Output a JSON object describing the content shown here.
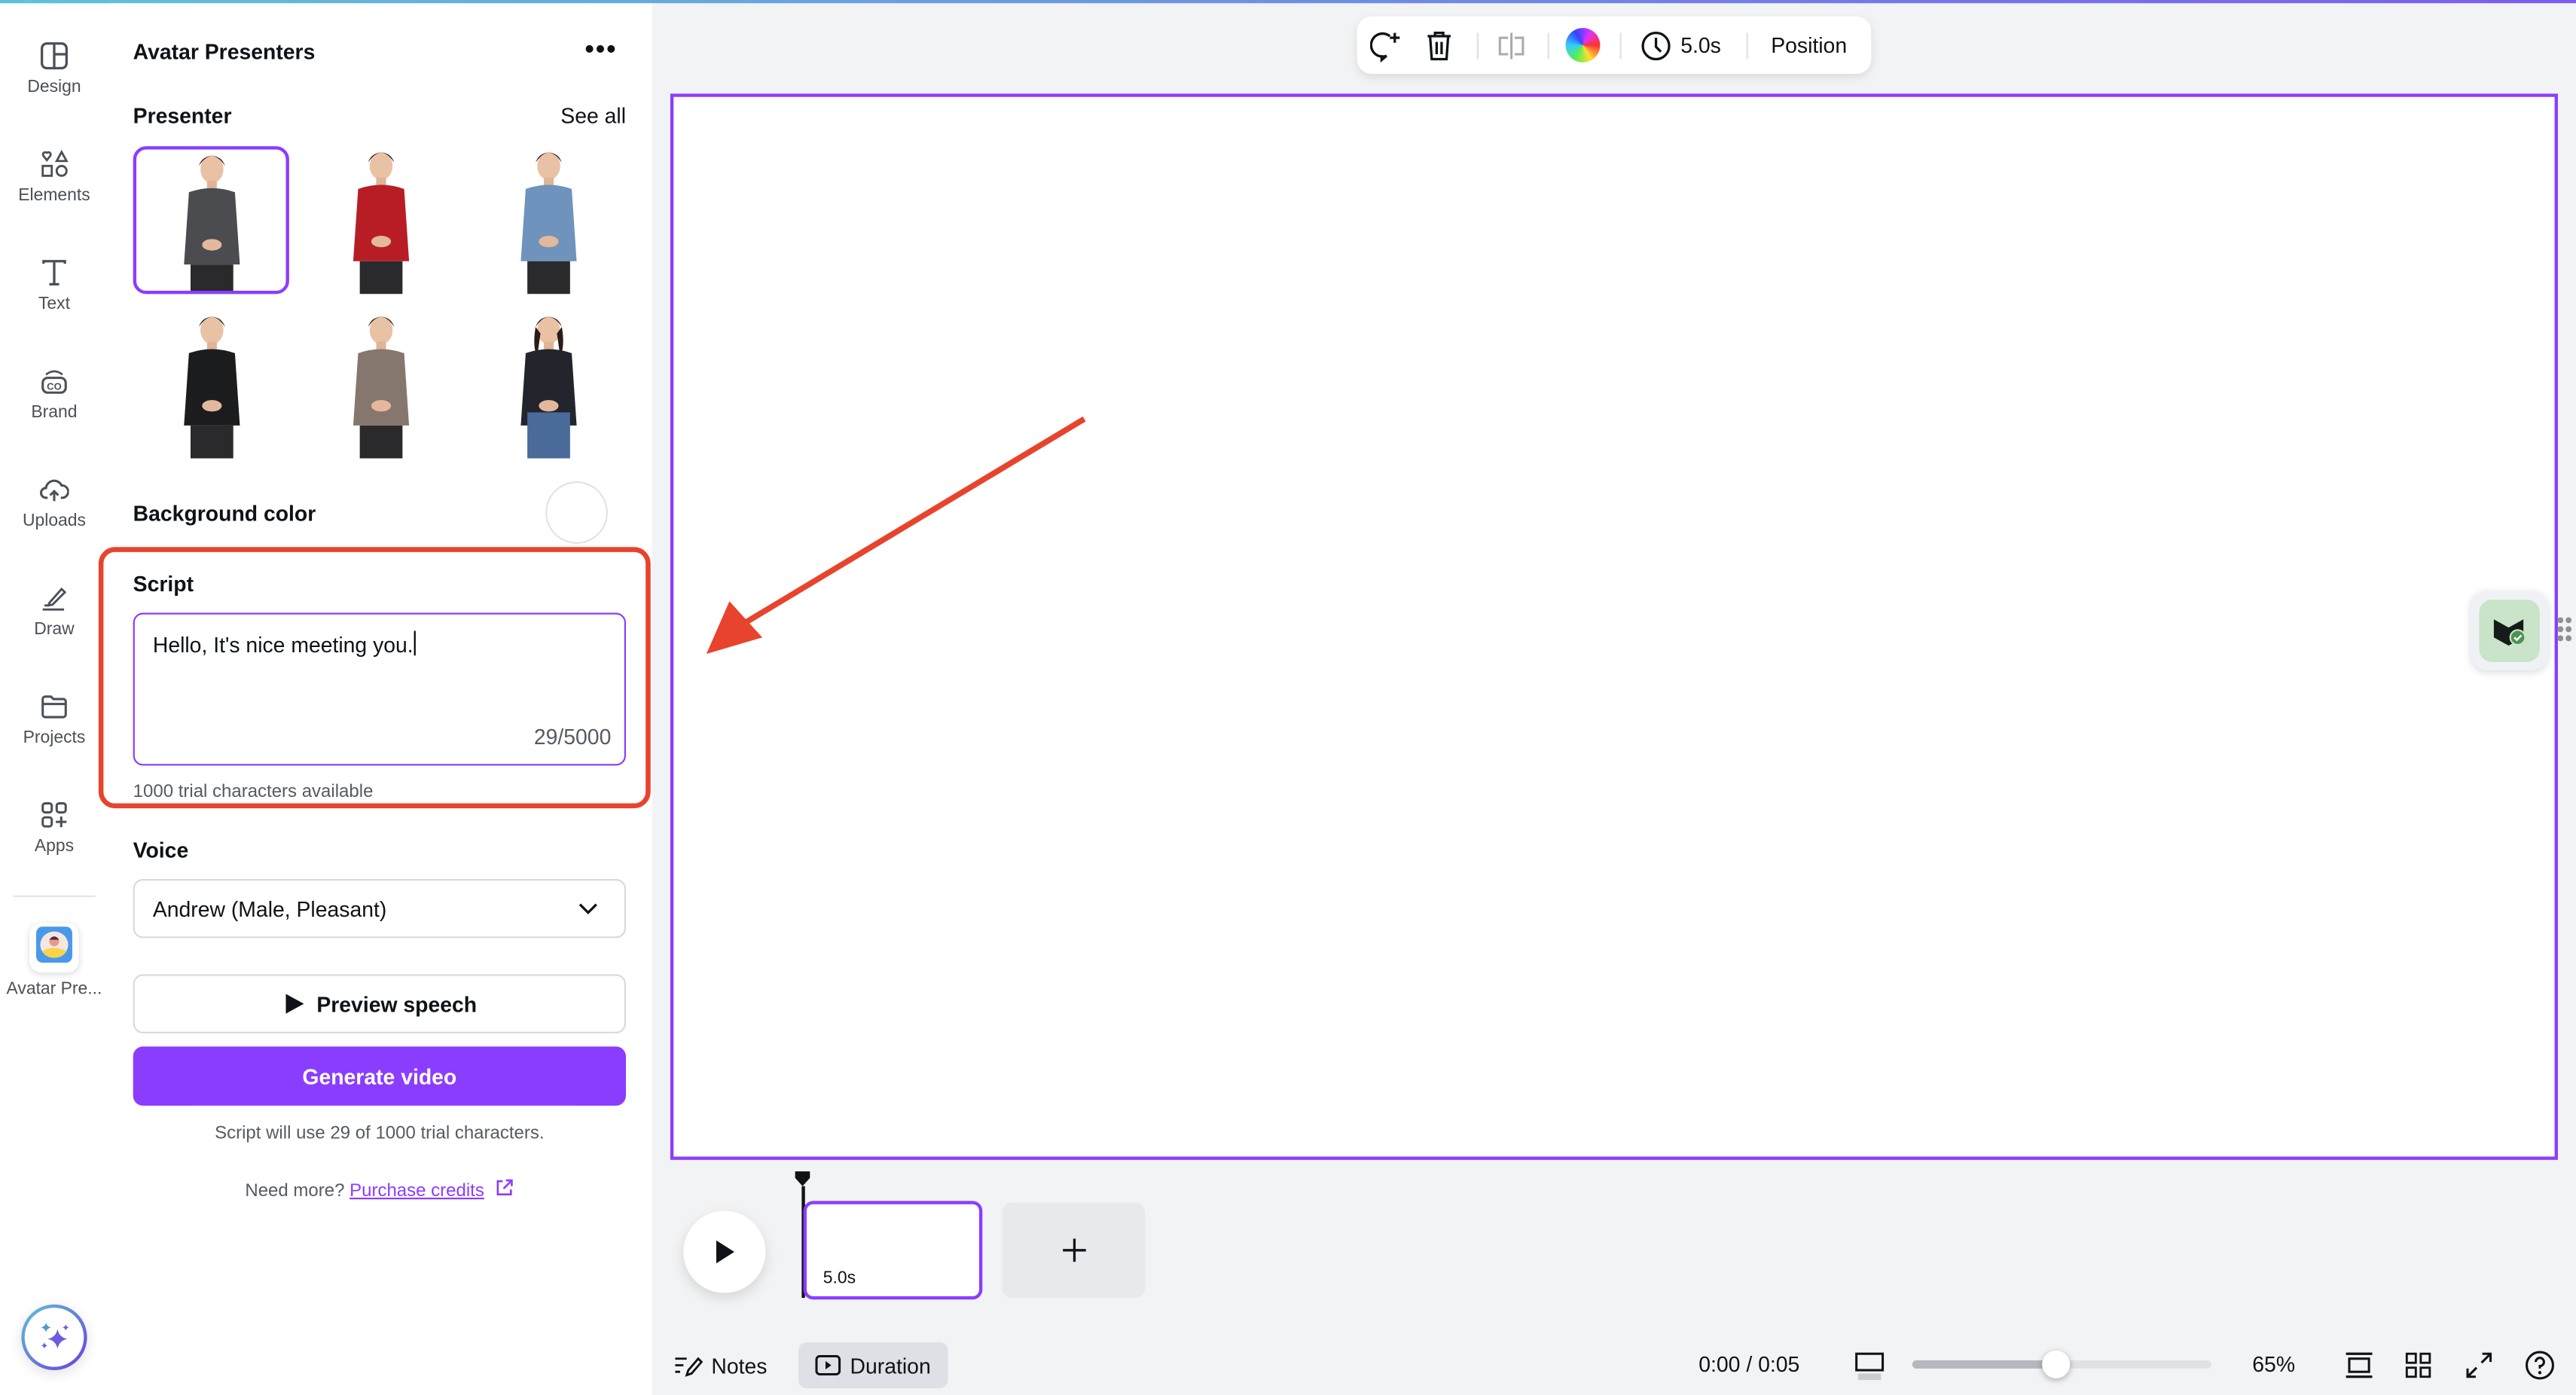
{
  "rail": {
    "items": [
      {
        "label": "Design",
        "icon": "design-icon"
      },
      {
        "label": "Elements",
        "icon": "elements-icon"
      },
      {
        "label": "Text",
        "icon": "text-icon"
      },
      {
        "label": "Brand",
        "icon": "brand-icon"
      },
      {
        "label": "Uploads",
        "icon": "upload-cloud-icon"
      },
      {
        "label": "Draw",
        "icon": "draw-icon"
      },
      {
        "label": "Projects",
        "icon": "folder-icon"
      },
      {
        "label": "Apps",
        "icon": "apps-icon"
      }
    ],
    "app": {
      "label": "Avatar Pre..."
    }
  },
  "panel": {
    "title": "Avatar Presenters",
    "presenter_label": "Presenter",
    "see_all": "See all",
    "presenters": [
      {
        "outfit": "#4a4c50",
        "selected": true
      },
      {
        "outfit": "#b81d26",
        "selected": false
      },
      {
        "outfit": "#6e93bd",
        "selected": false
      },
      {
        "outfit": "#1b1c1e",
        "selected": false
      },
      {
        "outfit": "#86776e",
        "selected": false
      },
      {
        "outfit": "#22252b",
        "selected": false
      }
    ],
    "background_color_label": "Background color",
    "script_label": "Script",
    "script_value": "Hello, It's nice meeting you.",
    "script_counter": "29/5000",
    "trial_available": "1000 trial characters available",
    "voice_label": "Voice",
    "voice_value": "Andrew (Male, Pleasant)",
    "preview_label": "Preview speech",
    "generate_label": "Generate video",
    "usage_note": "Script will use 29 of 1000 trial characters.",
    "need_more": "Need more?",
    "purchase_link": "Purchase credits"
  },
  "toolbar": {
    "duration": "5.0s",
    "position": "Position"
  },
  "timeline": {
    "clip_duration": "5.0s"
  },
  "footer": {
    "notes": "Notes",
    "duration": "Duration",
    "time": "0:00 / 0:05",
    "zoom": "65%",
    "zoom_percent": 65
  },
  "colors": {
    "accent": "#8b3dff",
    "highlight": "#e8432d",
    "annotation_arrow": "#e8432d"
  }
}
